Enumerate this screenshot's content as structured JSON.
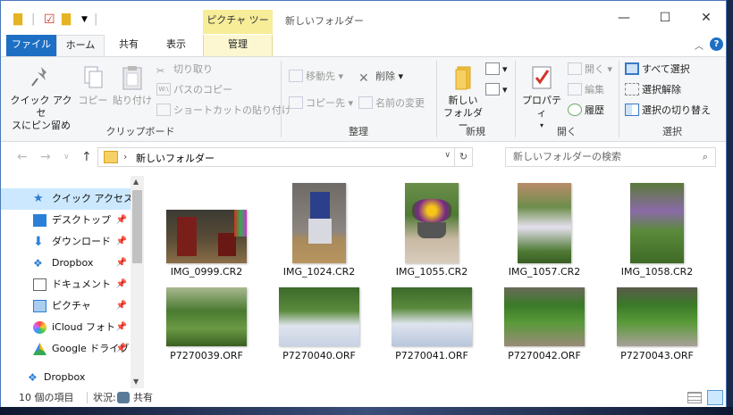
{
  "titlebar": {
    "context_header": "ピクチャ ツール",
    "window_title": "新しいフォルダー",
    "minimize": "—",
    "maximize": "☐",
    "close": "✕"
  },
  "tabs": {
    "file": "ファイル",
    "home": "ホーム",
    "share": "共有",
    "view": "表示",
    "manage": "管理"
  },
  "ribbon": {
    "clipboard": {
      "label": "クリップボード",
      "pin_line1": "クイック アクセ",
      "pin_line2": "スにピン留め",
      "copy": "コピー",
      "paste": "貼り付け",
      "cut": "切り取り",
      "copy_path": "パスのコピー",
      "paste_shortcut": "ショートカットの貼り付け"
    },
    "organize": {
      "label": "整理",
      "move_to": "移動先",
      "copy_to": "コピー先",
      "delete": "削除",
      "rename": "名前の変更"
    },
    "new": {
      "label": "新規",
      "new_folder_line1": "新しい",
      "new_folder_line2": "フォルダー"
    },
    "open": {
      "label": "開く",
      "properties": "プロパティ",
      "open": "開く",
      "edit": "編集",
      "history": "履歴"
    },
    "select": {
      "label": "選択",
      "select_all": "すべて選択",
      "select_none": "選択解除",
      "invert": "選択の切り替え"
    }
  },
  "address": {
    "path": "新しいフォルダー",
    "search_placeholder": "新しいフォルダーの検索"
  },
  "navpane": {
    "items": [
      {
        "label": "クイック アクセス"
      },
      {
        "label": "デスクトップ"
      },
      {
        "label": "ダウンロード"
      },
      {
        "label": "Dropbox"
      },
      {
        "label": "ドキュメント"
      },
      {
        "label": "ピクチャ"
      },
      {
        "label": "iCloud フォト"
      },
      {
        "label": "Google ドライブ"
      },
      {
        "label": "Dropbox"
      }
    ]
  },
  "files": [
    {
      "name": "IMG_0999.CR2"
    },
    {
      "name": "IMG_1024.CR2"
    },
    {
      "name": "IMG_1055.CR2"
    },
    {
      "name": "IMG_1057.CR2"
    },
    {
      "name": "IMG_1058.CR2"
    },
    {
      "name": "P7270039.ORF"
    },
    {
      "name": "P7270040.ORF"
    },
    {
      "name": "P7270041.ORF"
    },
    {
      "name": "P7270042.ORF"
    },
    {
      "name": "P7270043.ORF"
    }
  ],
  "status": {
    "count": "10 個の項目",
    "state_label": "状況:",
    "shared": "共有"
  },
  "colors": {
    "accent": "#1d6fc4",
    "context_tab": "#f7ec98",
    "nav_selected": "#cce8ff"
  }
}
